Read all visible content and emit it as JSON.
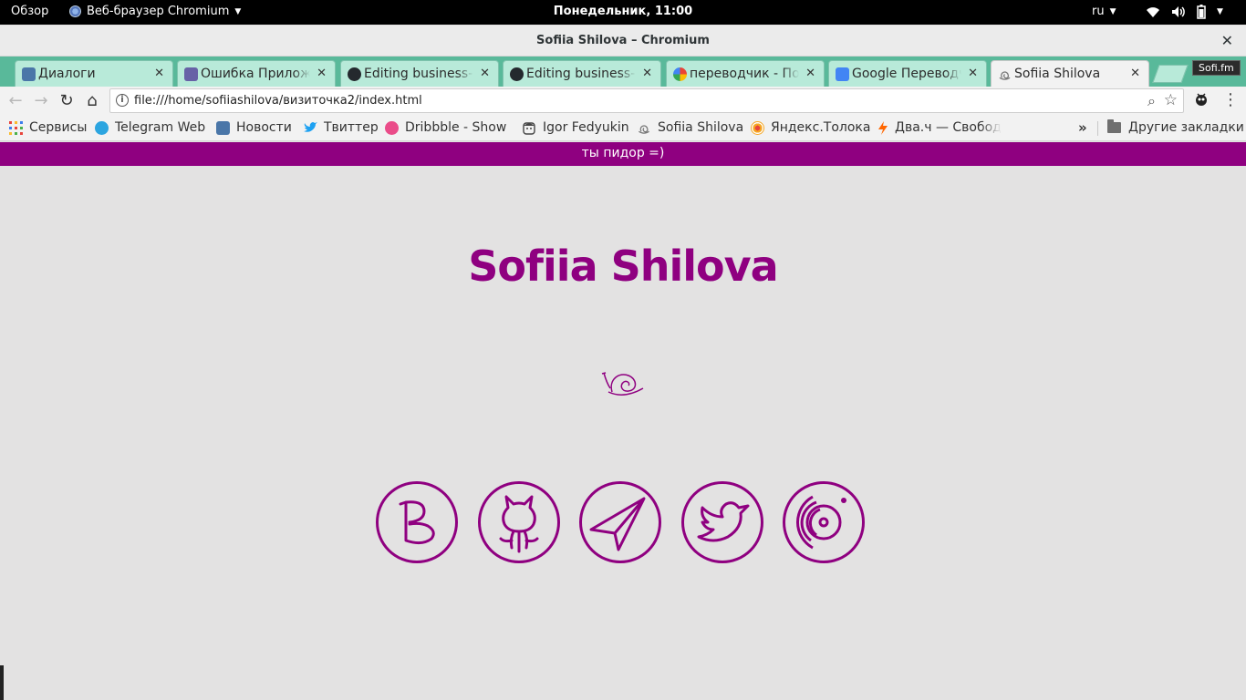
{
  "topbar": {
    "overview": "Обзор",
    "app_name": "Веб-браузер Chromium",
    "clock": "Понедельник, 11:00",
    "lang": "ru"
  },
  "window": {
    "title": "Sofiia Shilova – Chromium"
  },
  "tabs": [
    {
      "label": "Диалоги",
      "icon": "chat-icon",
      "color": "#4a76a8"
    },
    {
      "label": "Ошибка Приложения",
      "icon": "heroku-icon",
      "color": "#6762a6"
    },
    {
      "label": "Editing business-card",
      "icon": "github-icon",
      "color": "#24292e"
    },
    {
      "label": "Editing business-card",
      "icon": "github-icon",
      "color": "#24292e"
    },
    {
      "label": "переводчик - Поиск",
      "icon": "google-icon",
      "color": "#4285f4"
    },
    {
      "label": "Google Переводчик",
      "icon": "google-translate-icon",
      "color": "#4285f4"
    },
    {
      "label": "Sofiia Shilova",
      "icon": "snail-icon",
      "color": "#8f0080",
      "active": true
    }
  ],
  "extension_badge": "Sofi.fm",
  "address_bar": {
    "url": "file:///home/sofiiashilova/визиточка2/index.html"
  },
  "bookmarks": [
    {
      "label": "Сервисы",
      "icon": "apps-grid-icon",
      "color": "#e8453c"
    },
    {
      "label": "Telegram Web",
      "icon": "telegram-icon",
      "color": "#2ca5e0"
    },
    {
      "label": "Новости",
      "icon": "vk-icon",
      "color": "#4a76a8"
    },
    {
      "label": "Твиттер",
      "icon": "twitter-icon",
      "color": "#1da1f2"
    },
    {
      "label": "Dribbble - Show",
      "icon": "dribbble-icon",
      "color": "#ea4c89"
    },
    {
      "label": "Igor Fedyukin",
      "icon": "face-icon",
      "color": "#444444"
    },
    {
      "label": "Sofiia Shilova",
      "icon": "snail-icon",
      "color": "#777777"
    },
    {
      "label": "Яндекс.Толока",
      "icon": "toloka-icon",
      "color": "#f5a623"
    },
    {
      "label": "Два.ч — Свобод",
      "icon": "lightning-icon",
      "color": "#ff6600"
    }
  ],
  "other_bookmarks": "Другие закладки",
  "more_bookmarks": "»",
  "page": {
    "banner": "ты пидор =)",
    "title": "Sofiia Shilova",
    "accent_color": "#8f0080",
    "background_color": "#e3e2e2",
    "socials": [
      {
        "name": "vk-social-icon"
      },
      {
        "name": "github-social-icon"
      },
      {
        "name": "telegram-social-icon"
      },
      {
        "name": "twitter-social-icon"
      },
      {
        "name": "music-social-icon"
      }
    ]
  }
}
